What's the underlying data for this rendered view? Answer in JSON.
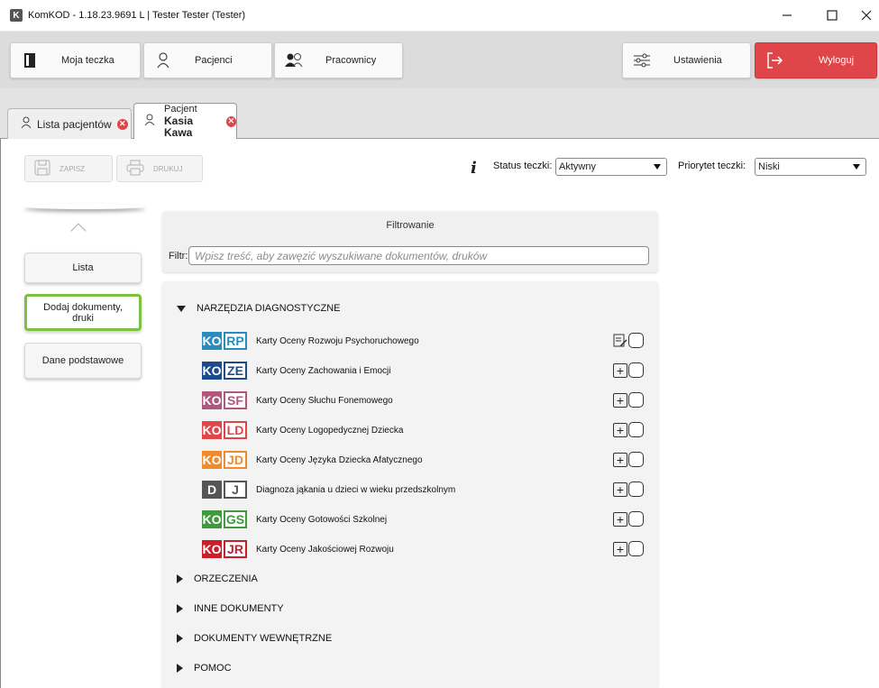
{
  "window": {
    "app_icon": "K",
    "title": "KomKOD - 1.18.23.9691 L | Tester Tester (Tester)"
  },
  "nav": {
    "moja_teczka": "Moja teczka",
    "pacjenci": "Pacjenci",
    "pracownicy": "Pracownicy",
    "ustawienia": "Ustawienia",
    "wyloguj": "Wyloguj"
  },
  "tabs": {
    "lista": "Lista pacjentów",
    "patient_line1": "Pacjent",
    "patient_line2": "Kasia Kawa"
  },
  "toolbar": {
    "save": "ZAPISZ",
    "print": "DRUKUJ",
    "status_label": "Status teczki:",
    "status_value": "Aktywny",
    "priority_label": "Priorytet teczki:",
    "priority_value": "Niski"
  },
  "sidebar": {
    "lista": "Lista",
    "dodaj": "Dodaj dokumenty, druki",
    "dane": "Dane podstawowe"
  },
  "filter": {
    "title": "Filtrowanie",
    "label": "Filtr:",
    "placeholder": "Wpisz treść, aby zawęzić wyszukiwane dokumentów, druków"
  },
  "tree": {
    "diag_title": "NARZĘDZIA DIAGNOSTYCZNE",
    "docs": [
      {
        "prefix": "KO",
        "suffix": "RP",
        "color": "#2a8bbd",
        "name": "Karty Oceny Rozwoju Psychoruchowego"
      },
      {
        "prefix": "KO",
        "suffix": "ZE",
        "color": "#1c4b8c",
        "name": "Karty Oceny Zachowania i Emocji"
      },
      {
        "prefix": "KO",
        "suffix": "SF",
        "color": "#b0577e",
        "name": "Karty Oceny Słuchu Fonemowego"
      },
      {
        "prefix": "KO",
        "suffix": "LD",
        "color": "#e0454a",
        "name": "Karty Oceny Logopedycznej Dziecka"
      },
      {
        "prefix": "KO",
        "suffix": "JD",
        "color": "#f08a2a",
        "name": "Karty Oceny Języka Dziecka Afatycznego"
      },
      {
        "prefix": "D",
        "suffix": "J",
        "color": "#555555",
        "name": "Diagnoza jąkania u dzieci w wieku przedszkolnym"
      },
      {
        "prefix": "KO",
        "suffix": "GS",
        "color": "#3f9a3b",
        "name": "Karty Oceny Gotowości Szkolnej"
      },
      {
        "prefix": "KO",
        "suffix": "JR",
        "color": "#c8202a",
        "name": "Karty Oceny Jakościowej Rozwoju"
      }
    ],
    "sections": [
      "ORZECZENIA",
      "INNE DOKUMENTY",
      "DOKUMENTY WEWNĘTRZNE",
      "POMOC"
    ]
  }
}
